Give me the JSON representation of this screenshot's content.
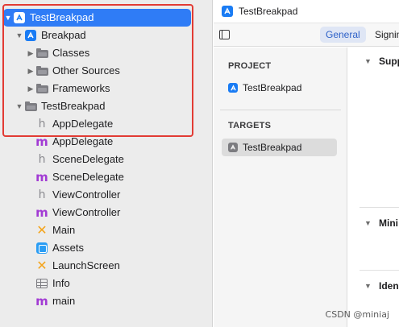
{
  "navigator": {
    "items": [
      {
        "label": "TestBreakpad",
        "icon": "xcode-project-icon",
        "disclosure": "expanded",
        "selected": true
      },
      {
        "label": "Breakpad",
        "icon": "xcode-project-icon",
        "disclosure": "expanded"
      },
      {
        "label": "Classes",
        "icon": "folder-icon",
        "disclosure": "collapsed"
      },
      {
        "label": "Other Sources",
        "icon": "folder-icon",
        "disclosure": "collapsed"
      },
      {
        "label": "Frameworks",
        "icon": "folder-icon",
        "disclosure": "collapsed"
      },
      {
        "label": "TestBreakpad",
        "icon": "folder-icon",
        "disclosure": "expanded"
      },
      {
        "label": "AppDelegate",
        "icon": "header-file-icon",
        "glyph": "h"
      },
      {
        "label": "AppDelegate",
        "icon": "objc-file-icon",
        "glyph": "m"
      },
      {
        "label": "SceneDelegate",
        "icon": "header-file-icon",
        "glyph": "h"
      },
      {
        "label": "SceneDelegate",
        "icon": "objc-file-icon",
        "glyph": "m"
      },
      {
        "label": "ViewController",
        "icon": "header-file-icon",
        "glyph": "h"
      },
      {
        "label": "ViewController",
        "icon": "objc-file-icon",
        "glyph": "m"
      },
      {
        "label": "Main",
        "icon": "storyboard-icon",
        "glyph": "✕"
      },
      {
        "label": "Assets",
        "icon": "asset-catalog-icon"
      },
      {
        "label": "LaunchScreen",
        "icon": "storyboard-icon",
        "glyph": "✕"
      },
      {
        "label": "Info",
        "icon": "plist-icon"
      },
      {
        "label": "main",
        "icon": "objc-file-icon",
        "glyph": "m"
      }
    ]
  },
  "editor": {
    "title": "TestBreakpad",
    "tabs": {
      "general": "General",
      "signing": "Signing"
    },
    "project_header": "PROJECT",
    "project_item": "TestBreakpad",
    "targets_header": "TARGETS",
    "target_item": "TestBreakpad",
    "sections": [
      "Supp",
      "Mini",
      "Iden"
    ]
  },
  "watermark": "CSDN @miniaj",
  "colors": {
    "selection": "#2f7cf6",
    "annotation_box": "#e23b34",
    "tab_active": "#2f62c8"
  }
}
